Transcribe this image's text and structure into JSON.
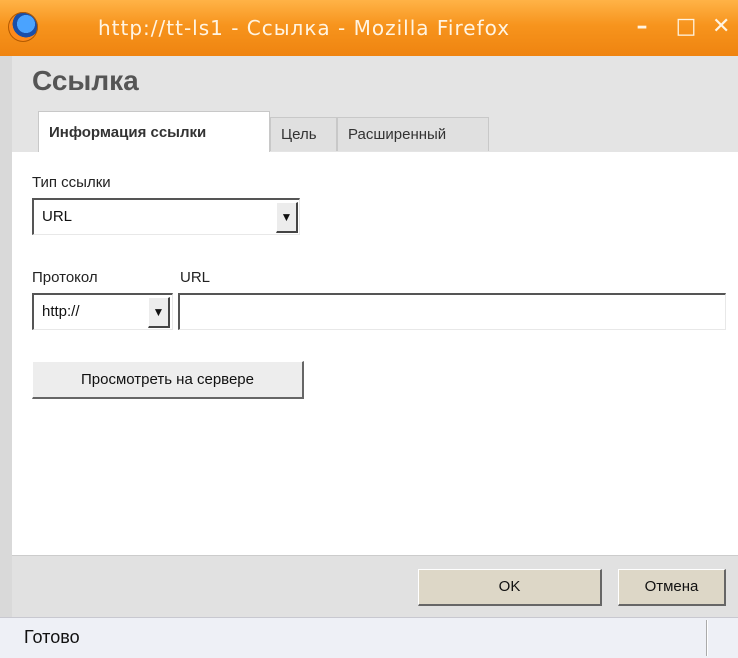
{
  "window": {
    "title": "http://tt-ls1 - Ссылка - Mozilla Firefox",
    "app_icon": "firefox-icon",
    "controls": {
      "minimize": "–",
      "maximize": "□",
      "close": "✕"
    }
  },
  "dialog": {
    "title": "Ссылка",
    "tabs": [
      {
        "label": "Информация ссылки",
        "active": true
      },
      {
        "label": "Цель",
        "active": false
      },
      {
        "label": "Расширенный",
        "active": false
      }
    ]
  },
  "form": {
    "link_type": {
      "label": "Тип ссылки",
      "value": "URL"
    },
    "protocol": {
      "label": "Протокол",
      "value": "http://"
    },
    "url": {
      "label": "URL",
      "value": ""
    },
    "browse_server_label": "Просмотреть на сервере"
  },
  "footer": {
    "ok_label": "OK",
    "cancel_label": "Отмена"
  },
  "status": {
    "text": "Готово"
  },
  "colors": {
    "titlebar": "#f7941d",
    "header_bg": "#e4e4e4",
    "footer_bg": "#e1e1e1",
    "status_bg": "#eef0f6"
  }
}
